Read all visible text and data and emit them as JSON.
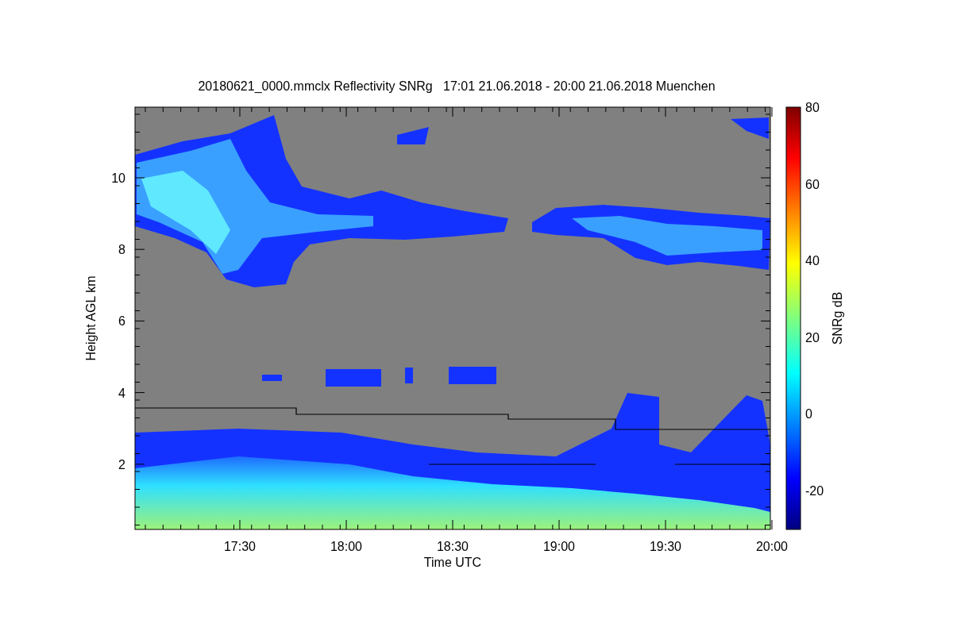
{
  "title": "20180621_0000.mmclx Reflectivity SNRg   17:01 21.06.2018 - 20:00 21.06.2018 Muenchen",
  "plot": {
    "ylabel": "Height AGL km",
    "yticks": [
      "10",
      "8",
      "6",
      "4",
      "2"
    ],
    "xlabel": "Time UTC",
    "xticks": [
      "17:30",
      "18:00",
      "18:30",
      "19:00",
      "19:30",
      "20:00"
    ]
  },
  "colorbar": {
    "label": "SNRg dB",
    "ticks": [
      "80",
      "60",
      "40",
      "20",
      "0",
      "-20"
    ]
  }
}
